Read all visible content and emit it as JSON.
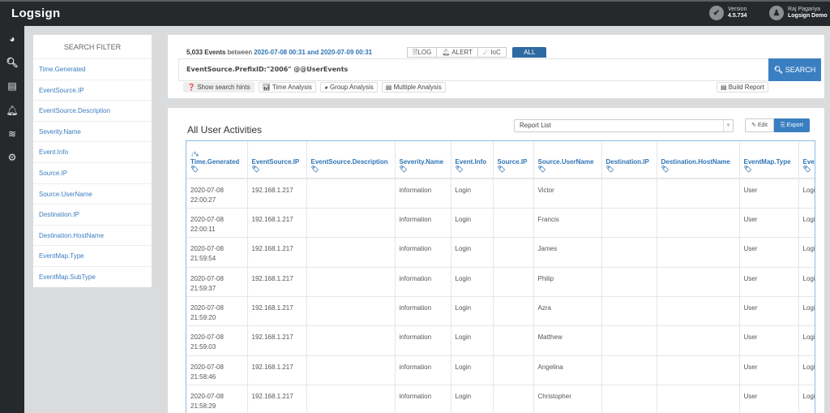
{
  "app": {
    "logo": "Logsign",
    "version_label": "Version",
    "version_value": "4.5.734",
    "user_name": "Raj Pagariya",
    "user_org": "Logsign Demo"
  },
  "sidenav": {
    "icons": [
      "dashboard-icon",
      "search-icon",
      "id-card-icon",
      "bell-icon",
      "wifi-icon",
      "gear-icon"
    ]
  },
  "filter": {
    "title": "SEARCH FILTER",
    "items": [
      "Time.Generated",
      "EventSource.IP",
      "EventSource.Description",
      "Severity.Name",
      "Event.Info",
      "Source.IP",
      "Source.UserName",
      "Destination.IP",
      "Destination.HostName",
      "EventMap.Type",
      "EventMap.SubType"
    ]
  },
  "search": {
    "count": "5,033 Events",
    "between": "between",
    "start": "2020-07-08 00:31",
    "and": "and",
    "end": "2020-07-09 00:31",
    "tabs": [
      {
        "icon": "🗎",
        "label": "LOG"
      },
      {
        "icon": "🔔︎",
        "label": "ALERT"
      },
      {
        "icon": "☄",
        "label": "IoC"
      },
      {
        "icon": "",
        "label": "ALL"
      }
    ],
    "active_tab": "ALL",
    "query": "EventSource.PrefixID:\"2006\" @@UserEvents",
    "search_button": "SEARCH",
    "tools": [
      {
        "icon": "❓",
        "label": "Show search hints"
      },
      {
        "icon": "📊︎",
        "label": "Time Analysis"
      },
      {
        "icon": "◕",
        "label": "Group Analysis"
      },
      {
        "icon": "▤",
        "label": "Multiple Analysis"
      }
    ],
    "build_report": "Build Report"
  },
  "results": {
    "title": "All User Activities",
    "report_select": "Report List",
    "edit_label": "Edit",
    "export_label": "Export",
    "columns": [
      "Time.Generated",
      "EventSource.IP",
      "EventSource.Description",
      "Severity.Name",
      "Event.Info",
      "Source.IP",
      "Source.UserName",
      "Destination.IP",
      "Destination.HostName",
      "EventMap.Type",
      "EventMap.SubType"
    ],
    "rows": [
      {
        "date": "2020-07-08",
        "time": "22:00:27",
        "ip": "192.168.1.217",
        "desc": "",
        "severity": "information",
        "info": "Login",
        "src_ip": "",
        "user": "Victor",
        "dst_ip": "",
        "dst_host": "",
        "type": "User",
        "subtype": "Login"
      },
      {
        "date": "2020-07-08",
        "time": "22:00:11",
        "ip": "192.168.1.217",
        "desc": "",
        "severity": "information",
        "info": "Login",
        "src_ip": "",
        "user": "Francis",
        "dst_ip": "",
        "dst_host": "",
        "type": "User",
        "subtype": "Login"
      },
      {
        "date": "2020-07-08",
        "time": "21:59:54",
        "ip": "192.168.1.217",
        "desc": "",
        "severity": "information",
        "info": "Login",
        "src_ip": "",
        "user": "James",
        "dst_ip": "",
        "dst_host": "",
        "type": "User",
        "subtype": "Login"
      },
      {
        "date": "2020-07-08",
        "time": "21:59:37",
        "ip": "192.168.1.217",
        "desc": "",
        "severity": "information",
        "info": "Login",
        "src_ip": "",
        "user": "Philip",
        "dst_ip": "",
        "dst_host": "",
        "type": "User",
        "subtype": "Login"
      },
      {
        "date": "2020-07-08",
        "time": "21:59:20",
        "ip": "192.168.1.217",
        "desc": "",
        "severity": "information",
        "info": "Login",
        "src_ip": "",
        "user": "Azra",
        "dst_ip": "",
        "dst_host": "",
        "type": "User",
        "subtype": "Login"
      },
      {
        "date": "2020-07-08",
        "time": "21:59:03",
        "ip": "192.168.1.217",
        "desc": "",
        "severity": "information",
        "info": "Login",
        "src_ip": "",
        "user": "Matthew",
        "dst_ip": "",
        "dst_host": "",
        "type": "User",
        "subtype": "Login"
      },
      {
        "date": "2020-07-08",
        "time": "21:58:46",
        "ip": "192.168.1.217",
        "desc": "",
        "severity": "information",
        "info": "Login",
        "src_ip": "",
        "user": "Angelina",
        "dst_ip": "",
        "dst_host": "",
        "type": "User",
        "subtype": "Login"
      },
      {
        "date": "2020-07-08",
        "time": "21:58:29",
        "ip": "192.168.1.217",
        "desc": "",
        "severity": "information",
        "info": "Login",
        "src_ip": "",
        "user": "Christopher",
        "dst_ip": "",
        "dst_host": "",
        "type": "User",
        "subtype": "Login"
      }
    ]
  },
  "colors": {
    "accent": "#3a7fc1",
    "link": "#2f74b5",
    "topbar": "#25292b"
  }
}
